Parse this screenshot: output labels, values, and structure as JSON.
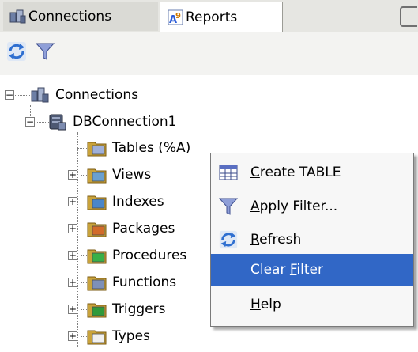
{
  "tabs": [
    {
      "label": "Connections",
      "icon": "connections-icon"
    },
    {
      "label": "Reports",
      "icon": "reports-icon"
    }
  ],
  "toolbar": {
    "refresh_icon": "refresh-icon",
    "filter_icon": "filter-icon"
  },
  "tree": {
    "root": {
      "label": "Connections",
      "icon": "connections-icon",
      "expander": "−"
    },
    "connection": {
      "label": "DBConnection1",
      "icon": "database-icon",
      "expander": "−"
    },
    "items": [
      {
        "label": "Tables (%A)",
        "icon": "tables-icon",
        "expander": ""
      },
      {
        "label": "Views",
        "icon": "views-icon",
        "expander": "+"
      },
      {
        "label": "Indexes",
        "icon": "indexes-icon",
        "expander": "+"
      },
      {
        "label": "Packages",
        "icon": "packages-icon",
        "expander": "+"
      },
      {
        "label": "Procedures",
        "icon": "procedures-icon",
        "expander": "+"
      },
      {
        "label": "Functions",
        "icon": "functions-icon",
        "expander": "+"
      },
      {
        "label": "Triggers",
        "icon": "triggers-icon",
        "expander": "+"
      },
      {
        "label": "Types",
        "icon": "types-icon",
        "expander": "+"
      }
    ]
  },
  "context_menu": {
    "items": [
      {
        "label_pre": "",
        "label_u": "C",
        "label_post": "reate TABLE",
        "icon": "table-icon",
        "selected": false
      },
      {
        "label_pre": "",
        "label_u": "A",
        "label_post": "pply Filter...",
        "icon": "filter-icon",
        "selected": false
      },
      {
        "label_pre": "",
        "label_u": "R",
        "label_post": "efresh",
        "icon": "refresh-icon",
        "selected": false
      },
      {
        "label_pre": "Clear ",
        "label_u": "F",
        "label_post": "ilter",
        "icon": "",
        "selected": true
      },
      {
        "label_pre": "",
        "label_u": "H",
        "label_post": "elp",
        "icon": "",
        "selected": false
      }
    ]
  },
  "colors": {
    "selection": "#3167c6",
    "tab_strip": "#e6e6e2",
    "menu_bg": "#f7f7f7"
  }
}
